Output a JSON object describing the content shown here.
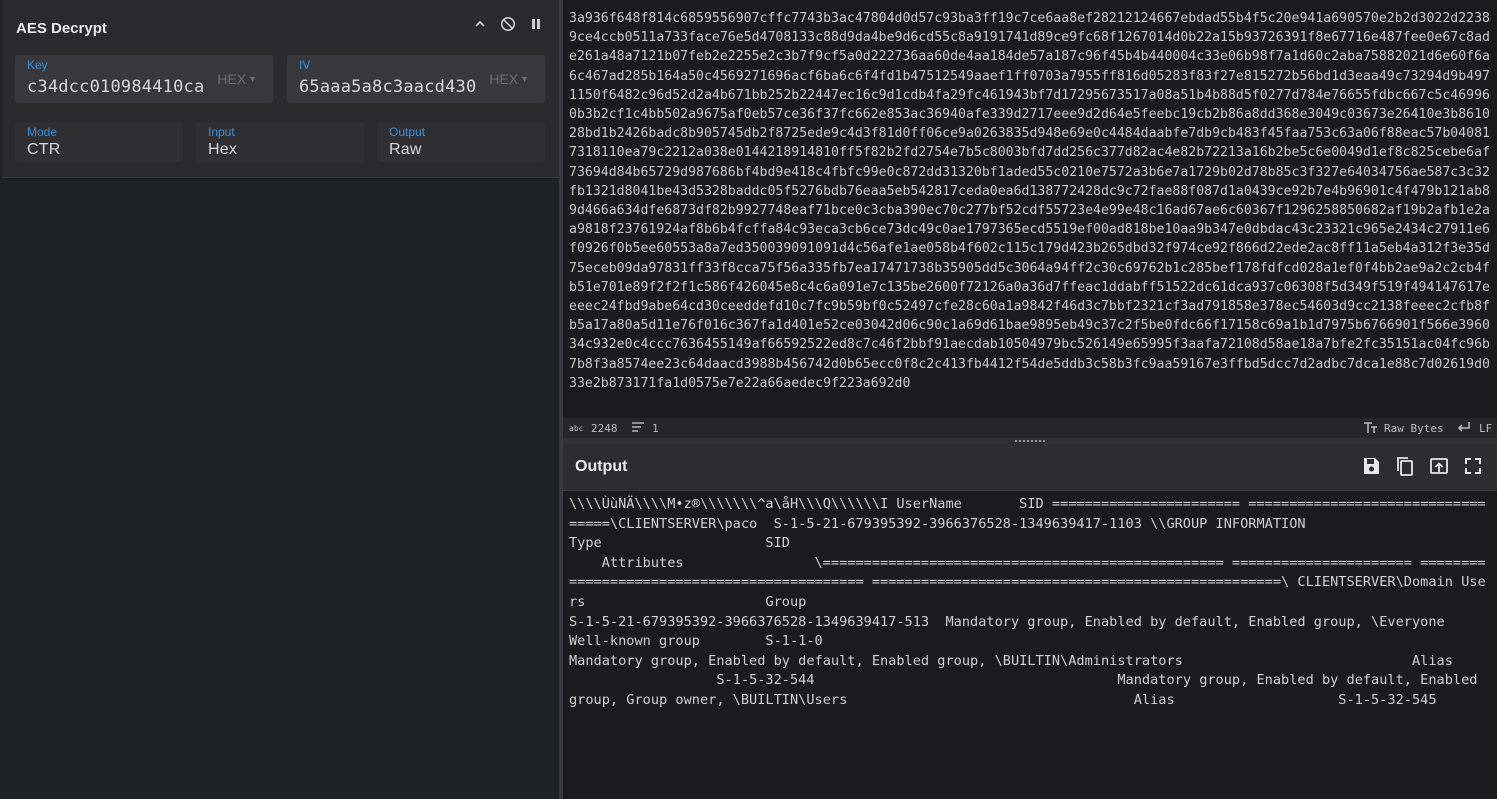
{
  "operation": {
    "title": "AES Decrypt",
    "key": {
      "label": "Key",
      "value": "c34dcc010984410ca",
      "encoding": "HEX"
    },
    "iv": {
      "label": "IV",
      "value": "65aaa5a8c3aacd430",
      "encoding": "HEX"
    },
    "mode": {
      "label": "Mode",
      "value": "CTR"
    },
    "input": {
      "label": "Input",
      "value": "Hex"
    },
    "output": {
      "label": "Output",
      "value": "Raw"
    }
  },
  "input_text": "3a936f648f814c6859556907cffc7743b3ac47804d0d57c93ba3ff19c7ce6aa8ef28212124667ebdad55b4f5c20e941a690570e2b2d3022d22389ce4ccb0511a733face76e5d4708133c88d9da4be9d6cd55c8a9191741d89ce9fc68f1267014d0b22a15b93726391f8e67716e487fee0e67c8ade261a48a7121b07feb2e2255e2c3b7f9cf5a0d222736aa60de4aa184de57a187c96f45b4b440004c33e06b98f7a1d60c2aba75882021d6e60f6a6c467ad285b164a50c4569271696acf6ba6c6f4fd1b47512549aaef1ff0703a7955ff816d05283f83f27e815272b56bd1d3eaa49c73294d9b4971150f6482c96d52d2a4b671bb252b22447ec16c9d1cdb4fa29fc461943bf7d17295673517a08a51b4b88d5f0277d784e76655fdbc667c5c469960b3b2cf1c4bb502a9675af0eb57ce36f37fc662e853ac36940afe339d2717eee9d2d64e5feebc19cb2b86a8dd368e3049c03673e26410e3b861028bd1b2426badc8b905745db2f8725ede9c4d3f81d0ff06ce9a0263835d948e69e0c4484daabfe7db9cb483f45faa753c63a06f88eac57b040817318110ea79c2212a038e0144218914810ff5f82b2fd2754e7b5c8003bfd7dd256c377d82ac4e82b72213a16b2be5c6e0049d1ef8c825cebe6af73694d84b65729d987686bf4bd9e418c4fbfc99e0c872dd31320bf1aded55c0210e7572a3b6e7a1729b02d78b85c3f327e64034756ae587c3c32fb1321d8041be43d5328baddc05f5276bdb76eaa5eb542817ceda0ea6d138772428dc9c72fae88f087d1a0439ce92b7e4b96901c4f479b121ab89d466a634dfe6873df82b9927748eaf71bce0c3cba390ec70c277bf52cdf55723e4e99e48c16ad67ae6c60367f1296258850682af19b2afb1e2aa9818f23761924af8b6b4fcffa84c93eca3cb6ce73dc49c0ae1797365ecd5519ef00ad818be10aa9b347e0dbdac43c23321c965e2434c27911e6f0926f0b5ee60553a8a7ed350039091091d4c56afe1ae058b4f602c115c179d423b265dbd32f974ce92f866d22ede2ac8ff11a5eb4a312f3e35d75eceb09da97831ff33f8cca75f56a335fb7ea17471738b35905dd5c3064a94ff2c30c69762b1c285bef178fdfcd028a1ef0f4bb2ae9a2c2cb4fb51e701e89f2f2f1c586f426045e8c4c6a091e7c135be2600f72126a0a36d7ffeac1ddabff51522dc61dca937c06308f5d349f519f494147617eeeec24fbd9abe64cd30ceeddefd10c7fc9b59bf0c52497cfe28c60a1a9842f46d3c7bbf2321cf3ad791858e378ec54603d9cc2138feeec2cfb8fb5a17a80a5d11e76f016c367fa1d401e52ce03042d06c90c1a69d61bae9895eb49c37c2f5be0fdc66f17158c69a1b1d7975b6766901f566e396034c932e0c4ccc7636455149af66592522ed8c7c46f2bbf91aecdab10504979bc526149e65995f3aafa72108d58ae18a7bfe2fc35151ac04fc96b7b8f3a8574ee23c64daacd3988b456742d0b65ecc0f8c2c413fb4412f54de5ddb3c58b3fc9aa59167e3ffbd5dcc7d2adbc7dca1e88c7d02619d033e2b873171fa1d0575e7e22a66aedec9f223a692d0",
  "input_status": {
    "length": "2248",
    "lines": "1",
    "format": "Raw Bytes",
    "eol": "LF"
  },
  "output": {
    "title": "Output",
    "text": "\\\\\\\\ÙùNÄ\\\\\\\\M•z®\\\\\\\\\\\\\\^a\\åH\\\\\\Q\\\\\\\\\\\\I UserName       SID ======================= ==================================\\CLIENTSERVER\\paco  S-1-5-21-679395392-3966376528-1349639417-1103 \\\\GROUP INFORMATION                             Type                    SID\n    Attributes                \\================================================= ====================== ============================================ ==================================================\\ CLIENTSERVER\\Domain Users                      Group\nS-1-5-21-679395392-3966376528-1349639417-513  Mandatory group, Enabled by default, Enabled group, \\Everyone                                        Well-known group        S-1-1-0\nMandatory group, Enabled by default, Enabled group, \\BUILTIN\\Administrators                            Alias\n                  S-1-5-32-544                                     Mandatory group, Enabled by default, Enabled group, Group owner, \\BUILTIN\\Users                                   Alias                    S-1-5-32-545"
  }
}
